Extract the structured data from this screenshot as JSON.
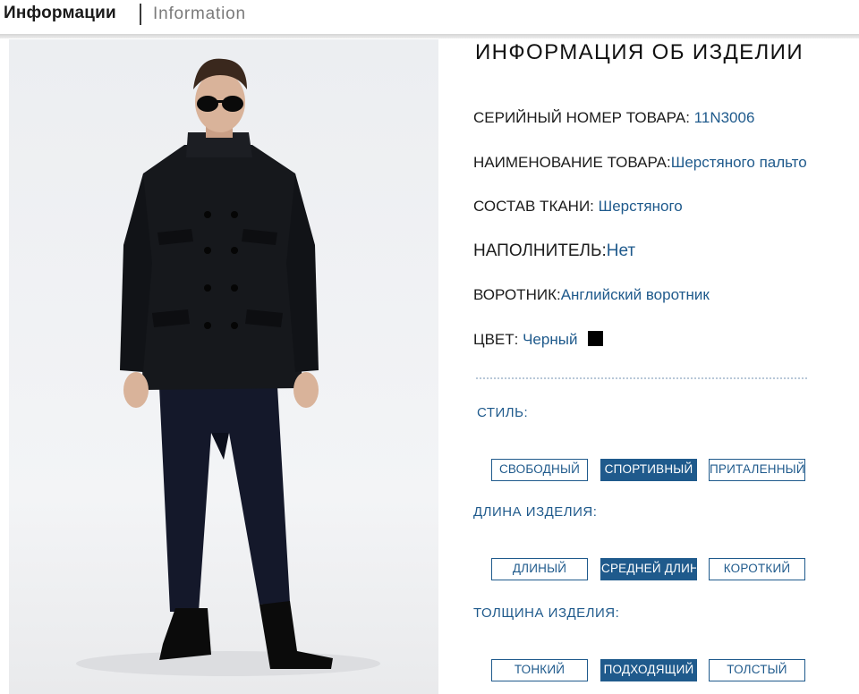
{
  "header": {
    "title_ru": "Информации",
    "title_en": "Information"
  },
  "photo": {
    "description_icon": "model-photo"
  },
  "info": {
    "title": "ИНФОРМАЦИЯ ОБ ИЗДЕЛИИ",
    "rows": [
      {
        "label": "СЕРИЙНЫЙ НОМЕР ТОВАРА: ",
        "value": "11N3006"
      },
      {
        "label": "НАИМЕНОВАНИЕ ТОВАРА:",
        "value": "Шерстяного пальто"
      },
      {
        "label": "СОСТАВ ТКАНИ: ",
        "value": "Шерстяного"
      },
      {
        "label": "НАПОЛНИТЕЛЬ:",
        "value": "Нет"
      },
      {
        "label": "ВОРОТНИК:",
        "value": "Английский воротник"
      },
      {
        "label": "ЦВЕТ: ",
        "value": "Черный"
      }
    ],
    "color_swatch": "#000000"
  },
  "style": {
    "label": "СТИЛЬ:",
    "options": [
      "СВОБОДНЫЙ",
      "СПОРТИВНЫЙ",
      "ПРИТАЛЕННЫЙ"
    ],
    "selected": "СПОРТИВНЫЙ"
  },
  "length": {
    "label": "ДЛИНА ИЗДЕЛИЯ:",
    "options": [
      "ДЛИНЫЙ",
      "СРЕДНЕЙ ДЛИНЫ",
      "КОРОТКИЙ"
    ],
    "selected": "СРЕДНЕЙ ДЛИНЫ"
  },
  "thickness": {
    "label": "ТОЛЩИНА ИЗДЕЛИЯ:",
    "options": [
      "ТОНКИЙ",
      "ПОДХОДЯЩИЙ",
      "ТОЛСТЫЙ"
    ],
    "selected": "ПОДХОДЯЩИЙ"
  },
  "colors": {
    "accent": "#1f5a8c",
    "text": "#1c1c1c"
  }
}
